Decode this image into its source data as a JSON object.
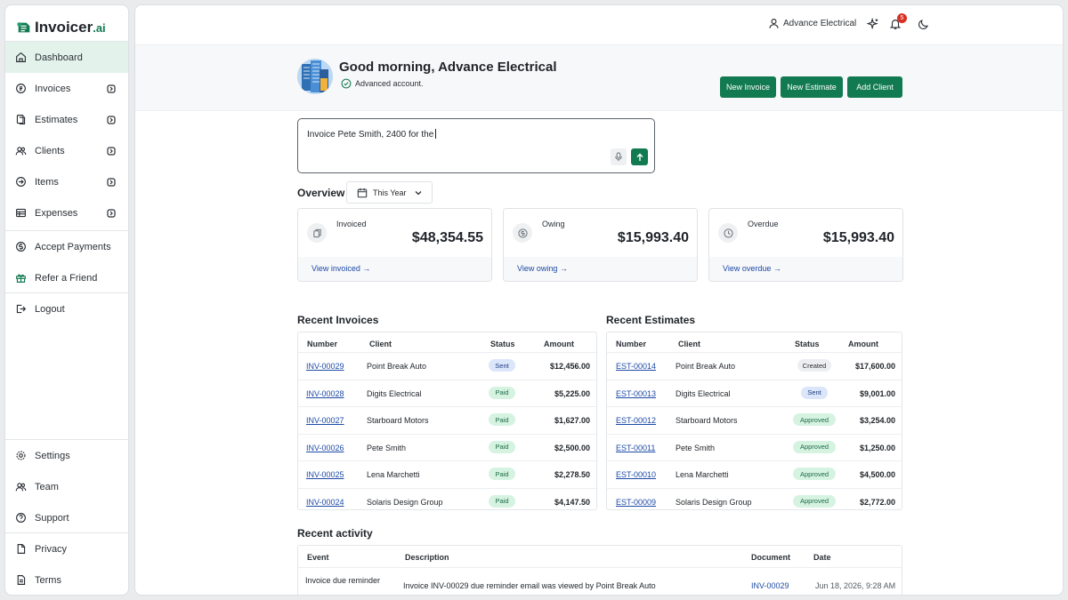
{
  "app": {
    "logo_text": "Invoicer",
    "logo_suffix": ".ai",
    "accent": "#127a51"
  },
  "sidebar": {
    "items": [
      {
        "label": "Dashboard",
        "icon": "home-icon"
      },
      {
        "label": "Invoices",
        "icon": "invoice-icon"
      },
      {
        "label": "Estimates",
        "icon": "estimate-icon"
      },
      {
        "label": "Clients",
        "icon": "clients-icon"
      },
      {
        "label": "Items",
        "icon": "items-icon"
      },
      {
        "label": "Expenses",
        "icon": "expenses-icon"
      },
      {
        "label": "Accept Payments",
        "icon": "payments-icon"
      },
      {
        "label": "Refer a Friend",
        "icon": "gift-icon"
      },
      {
        "label": "Logout",
        "icon": "logout-icon"
      }
    ],
    "bottom": [
      {
        "label": "Settings",
        "icon": "gear-icon"
      },
      {
        "label": "Team",
        "icon": "team-icon"
      },
      {
        "label": "Support",
        "icon": "help-icon"
      },
      {
        "label": "Privacy",
        "icon": "privacy-icon"
      },
      {
        "label": "Terms",
        "icon": "terms-icon"
      }
    ]
  },
  "topbar": {
    "account_name": "Advance Electrical",
    "notification_count": "5"
  },
  "hero": {
    "greeting": "Good morning, Advance Electrical",
    "account_type": "Advanced account.",
    "buttons": {
      "new_invoice": "New Invoice",
      "new_estimate": "New Estimate",
      "add_client": "Add Client"
    }
  },
  "prompt": {
    "value": "Invoice Pete Smith, 2400 for the"
  },
  "overview": {
    "title": "Overview",
    "period": "This Year",
    "cards": [
      {
        "label": "Invoiced",
        "amount": "$48,354.55",
        "link": "View invoiced →"
      },
      {
        "label": "Owing",
        "amount": "$15,993.40",
        "link": "View owing →"
      },
      {
        "label": "Overdue",
        "amount": "$15,993.40",
        "link": "View overdue →"
      }
    ]
  },
  "recent_invoices": {
    "title": "Recent Invoices",
    "headers": {
      "number": "Number",
      "client": "Client",
      "status": "Status",
      "amount": "Amount"
    },
    "rows": [
      {
        "number": "INV-00029",
        "client": "Point Break Auto",
        "status": "Sent",
        "amount": "$12,456.00"
      },
      {
        "number": "INV-00028",
        "client": "Digits Electrical",
        "status": "Paid",
        "amount": "$5,225.00"
      },
      {
        "number": "INV-00027",
        "client": "Starboard Motors",
        "status": "Paid",
        "amount": "$1,627.00"
      },
      {
        "number": "INV-00026",
        "client": "Pete Smith",
        "status": "Paid",
        "amount": "$2,500.00"
      },
      {
        "number": "INV-00025",
        "client": "Lena Marchetti",
        "status": "Paid",
        "amount": "$2,278.50"
      },
      {
        "number": "INV-00024",
        "client": "Solaris Design Group",
        "status": "Paid",
        "amount": "$4,147.50"
      }
    ]
  },
  "recent_estimates": {
    "title": "Recent Estimates",
    "headers": {
      "number": "Number",
      "client": "Client",
      "status": "Status",
      "amount": "Amount"
    },
    "rows": [
      {
        "number": "EST-00014",
        "client": "Point Break Auto",
        "status": "Created",
        "amount": "$17,600.00"
      },
      {
        "number": "EST-00013",
        "client": "Digits Electrical",
        "status": "Sent",
        "amount": "$9,001.00"
      },
      {
        "number": "EST-00012",
        "client": "Starboard Motors",
        "status": "Approved",
        "amount": "$3,254.00"
      },
      {
        "number": "EST-00011",
        "client": "Pete Smith",
        "status": "Approved",
        "amount": "$1,250.00"
      },
      {
        "number": "EST-00010",
        "client": "Lena Marchetti",
        "status": "Approved",
        "amount": "$4,500.00"
      },
      {
        "number": "EST-00009",
        "client": "Solaris Design Group",
        "status": "Approved",
        "amount": "$2,772.00"
      }
    ]
  },
  "recent_activity": {
    "title": "Recent activity",
    "headers": {
      "event": "Event",
      "description": "Description",
      "document": "Document",
      "date": "Date"
    },
    "rows": [
      {
        "event": "Invoice due reminder",
        "description": "Invoice INV-00029 due reminder email was viewed by Point Break Auto",
        "document": "INV-00029",
        "date": "Jun 18, 2026, 9:28 AM"
      }
    ]
  }
}
